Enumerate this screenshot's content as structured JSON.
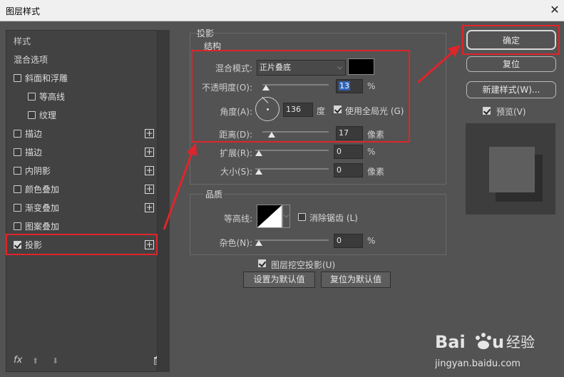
{
  "window": {
    "title": "图层样式",
    "close": "✕"
  },
  "left_panel": {
    "header": "样式",
    "blend_options": "混合选项",
    "items": [
      {
        "label": "斜面和浮雕",
        "checked": false,
        "plus": false
      },
      {
        "label": "等高线",
        "checked": false,
        "plus": false
      },
      {
        "label": "纹理",
        "checked": false,
        "plus": false
      },
      {
        "label": "描边",
        "checked": false,
        "plus": true
      },
      {
        "label": "描边",
        "checked": false,
        "plus": true
      },
      {
        "label": "内阴影",
        "checked": false,
        "plus": true
      },
      {
        "label": "颜色叠加",
        "checked": false,
        "plus": true
      },
      {
        "label": "渐变叠加",
        "checked": false,
        "plus": true
      },
      {
        "label": "图案叠加",
        "checked": false,
        "plus": false
      },
      {
        "label": "投影",
        "checked": true,
        "plus": true
      }
    ],
    "footer": {
      "fx": "fx",
      "up": "⬆",
      "down": "⬇",
      "trash": "🗑"
    }
  },
  "shadow": {
    "title": "投影",
    "structure": "结构",
    "blend_mode_label": "混合模式:",
    "blend_mode_value": "正片叠底",
    "opacity_label": "不透明度(O):",
    "opacity_value": "13",
    "opacity_unit": "%",
    "angle_label": "角度(A):",
    "angle_value": "136",
    "angle_unit": "度",
    "global_light_label": "使用全局光 (G)",
    "distance_label": "距离(D):",
    "distance_value": "17",
    "distance_unit": "像素",
    "spread_label": "扩展(R):",
    "spread_value": "0",
    "spread_unit": "%",
    "size_label": "大小(S):",
    "size_value": "0",
    "size_unit": "像素",
    "quality": "品质",
    "contour_label": "等高线:",
    "antialias_label": "消除锯齿 (L)",
    "noise_label": "杂色(N):",
    "noise_value": "0",
    "noise_unit": "%",
    "knockout_label": "图层挖空投影(U)",
    "set_default": "设置为默认值",
    "reset_default": "复位为默认值"
  },
  "buttons": {
    "ok": "确定",
    "reset": "复位",
    "new_style": "新建样式(W)...",
    "preview": "预览(V)"
  },
  "colors": {
    "highlight_red": "#e0242b",
    "shadow_color": "#000000"
  }
}
